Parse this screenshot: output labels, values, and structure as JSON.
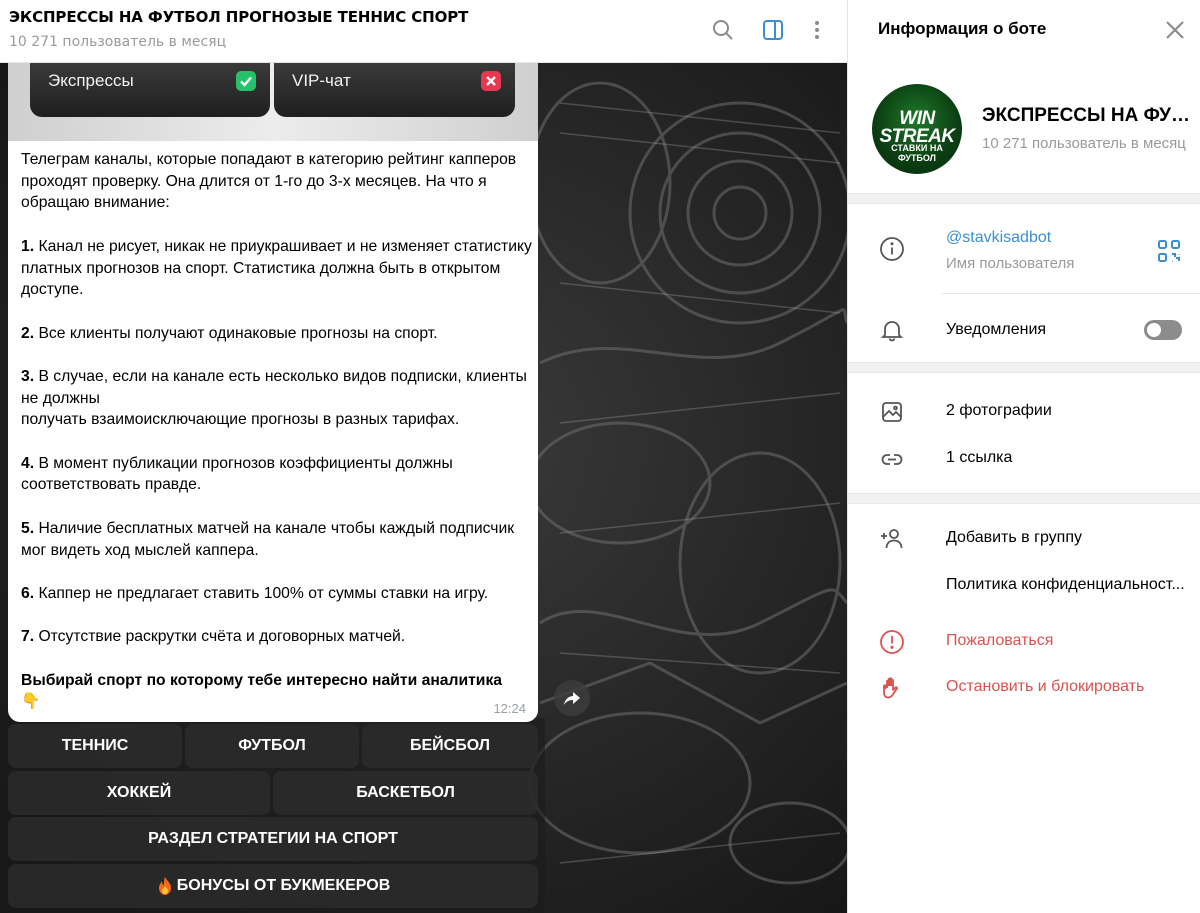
{
  "chat": {
    "title": "ЭКСПРЕССЫ НА ФУТБОЛ ПРОГНОЗЫЕ ТЕННИС СПОРТ",
    "subtitle": "10 271 пользователь в месяц",
    "icons": [
      "search-icon",
      "sidebar-toggle-icon",
      "more-vertical-icon"
    ]
  },
  "message": {
    "media": {
      "card1_label": "Экспрессы",
      "card1_status": "check",
      "card2_label": "VIP-чат",
      "card2_status": "cross"
    },
    "intro": "Телеграм каналы, которые попадают в категорию рейтинг капперов проходят проверку. Она длится от 1-го до 3-х месяцев. На что я обращаю внимание:",
    "points": [
      {
        "num": "1.",
        "text": " Канал не рисует, никак не приукрашивает и не изменяет статистику платных прогнозов на спорт. Статистика должна быть в открытом доступе."
      },
      {
        "num": "2.",
        "text": " Все клиенты получают одинаковые прогнозы на спорт."
      },
      {
        "num": "3.",
        "text": " В случае, если на канале есть несколько видов подписки, клиенты не должны"
      },
      {
        "num": "",
        "text": "получать взаимоисключающие прогнозы в разных тарифах."
      },
      {
        "num": "4.",
        "text": " В момент публикации прогнозов коэффициенты должны соответствовать правде."
      },
      {
        "num": "5.",
        "text": " Наличие бесплатных матчей на канале чтобы каждый подписчик мог видеть ход мыслей каппера."
      },
      {
        "num": "6.",
        "text": " Каппер не предлагает ставить 100% от суммы ставки на игру."
      },
      {
        "num": "7.",
        "text": " Отсутствие раскрутки счёта и договорных матчей."
      }
    ],
    "outro": "Выбирай спорт по которому тебе интересно найти аналитика",
    "outro_emoji": "👇",
    "time": "12:24"
  },
  "keyboard": {
    "row1": [
      "ТЕННИС",
      "ФУТБОЛ",
      "БЕЙСБОЛ"
    ],
    "row2": [
      "ХОККЕЙ",
      "БАСКЕТБОЛ"
    ],
    "row3": [
      "РАЗДЕЛ СТРАТЕГИИ НА СПОРТ"
    ],
    "row4": [
      "БОНУСЫ ОТ БУКМЕКЕРОВ"
    ],
    "row4_icon": "fire-icon"
  },
  "panel": {
    "title": "Информация о боте",
    "bot_name": "ЭКСПРЕССЫ НА ФУТБОЛ ПРОГНОЗЫЕ ТЕННИС СПОРТ",
    "bot_users": "10 271 пользователь в месяц",
    "avatar_line1": "WIN",
    "avatar_line2": "STREAK",
    "avatar_line3": "СТАВКИ НА",
    "avatar_line4": "ФУТБОЛ",
    "username": "@stavkisadbot",
    "username_label": "Имя пользователя",
    "notifications_label": "Уведомления",
    "notifications_on": false,
    "photos": "2 фотографии",
    "links": "1 ссылка",
    "add_to_group": "Добавить в группу",
    "privacy": "Политика конфиденциальност...",
    "report": "Пожаловаться",
    "block": "Остановить и блокировать"
  },
  "colors": {
    "accent": "#3a8fd4",
    "danger": "#d9534f",
    "check_green": "#25c26b",
    "cross_red": "#e8384f",
    "avatar_green": "#1f7a2a"
  }
}
